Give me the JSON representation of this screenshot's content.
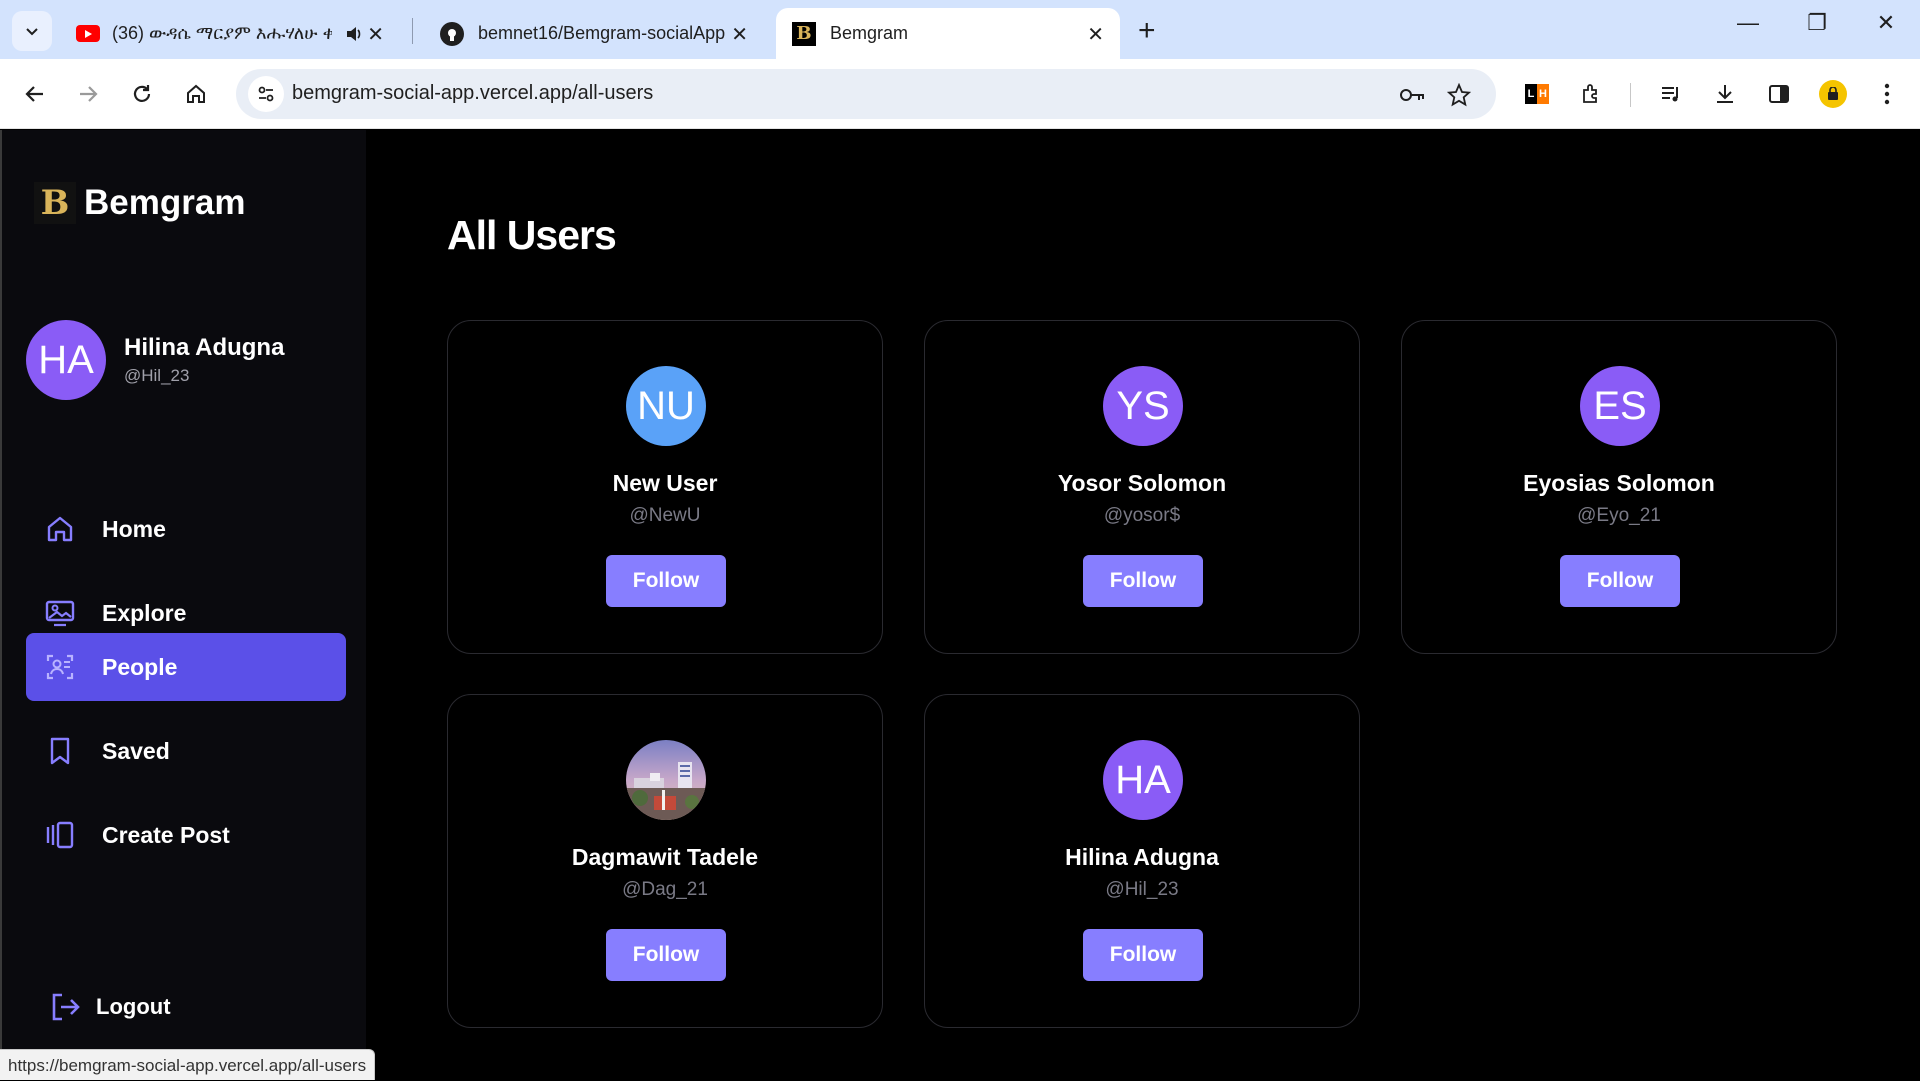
{
  "browser": {
    "tabs": [
      {
        "title": "(36) ውዳሴ ማርያም እሑሃለሁ ቀ",
        "icon": "youtube-icon"
      },
      {
        "title": "bemnet16/Bemgram-socialApp",
        "icon": "github-icon"
      },
      {
        "title": "Bemgram",
        "icon": "bemgram-icon",
        "active": true
      }
    ],
    "url": "bemgram-social-app.vercel.app/all-users",
    "status_url": "https://bemgram-social-app.vercel.app/all-users"
  },
  "sidebar": {
    "brand": "Bemgram",
    "user": {
      "initials": "HA",
      "name": "Hilina Adugna",
      "handle": "@Hil_23"
    },
    "nav": [
      {
        "label": "Home",
        "icon": "home-icon"
      },
      {
        "label": "Explore",
        "icon": "explore-icon"
      },
      {
        "label": "People",
        "icon": "people-icon",
        "active": true
      },
      {
        "label": "Saved",
        "icon": "bookmark-icon"
      },
      {
        "label": "Create Post",
        "icon": "create-post-icon"
      }
    ],
    "logout": "Logout"
  },
  "main": {
    "title": "All Users",
    "users": [
      {
        "initials": "NU",
        "name": "New User",
        "handle": "@NewU",
        "avatar_color": "#5aa2f8",
        "follow": "Follow"
      },
      {
        "initials": "YS",
        "name": "Yosor Solomon",
        "handle": "@yosor$",
        "avatar_color": "#8a5cf6",
        "follow": "Follow"
      },
      {
        "initials": "ES",
        "name": "Eyosias Solomon",
        "handle": "@Eyo_21",
        "avatar_color": "#8a5cf6",
        "follow": "Follow"
      },
      {
        "initials": "",
        "name": "Dagmawit Tadele",
        "handle": "@Dag_21",
        "avatar_color": "photo",
        "follow": "Follow"
      },
      {
        "initials": "HA",
        "name": "Hilina Adugna",
        "handle": "@Hil_23",
        "avatar_color": "#8a5cf6",
        "follow": "Follow"
      }
    ]
  },
  "colors": {
    "accent": "#5b50e8",
    "follow_button": "#877eff",
    "avatar_purple": "#8a5cf6",
    "avatar_blue": "#5aa2f8"
  }
}
